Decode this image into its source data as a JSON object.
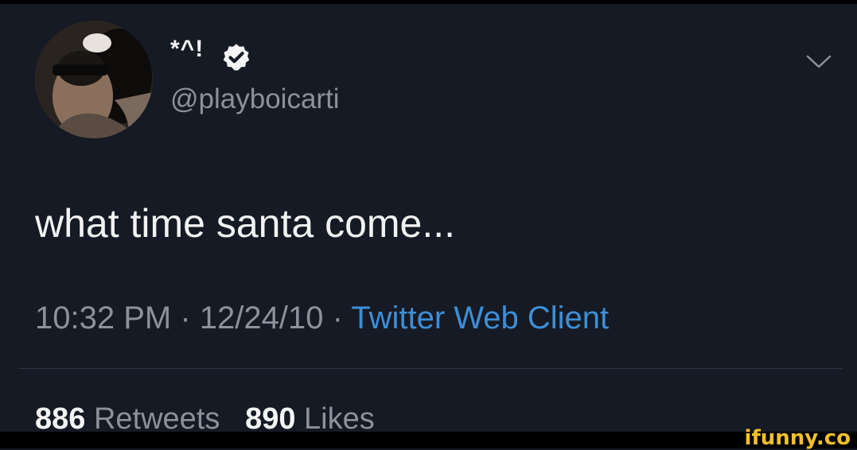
{
  "tweet": {
    "display_name": "*^!",
    "handle": "@playboicarti",
    "text": "what time santa come...",
    "time": "10:32 PM",
    "date": "12/24/10",
    "separator": "·",
    "client": "Twitter Web Client",
    "retweets_count": "886",
    "retweets_label": "Retweets",
    "likes_count": "890",
    "likes_label": "Likes"
  },
  "icons": {
    "verified": "verified-badge-icon",
    "menu": "chevron-down-icon"
  },
  "colors": {
    "background": "#151a24",
    "text_primary": "#f2f2f2",
    "text_secondary": "#8a929c",
    "link": "#3d8fd6",
    "watermark": "#f2c029"
  },
  "watermark": {
    "text": "ifunny.co"
  }
}
